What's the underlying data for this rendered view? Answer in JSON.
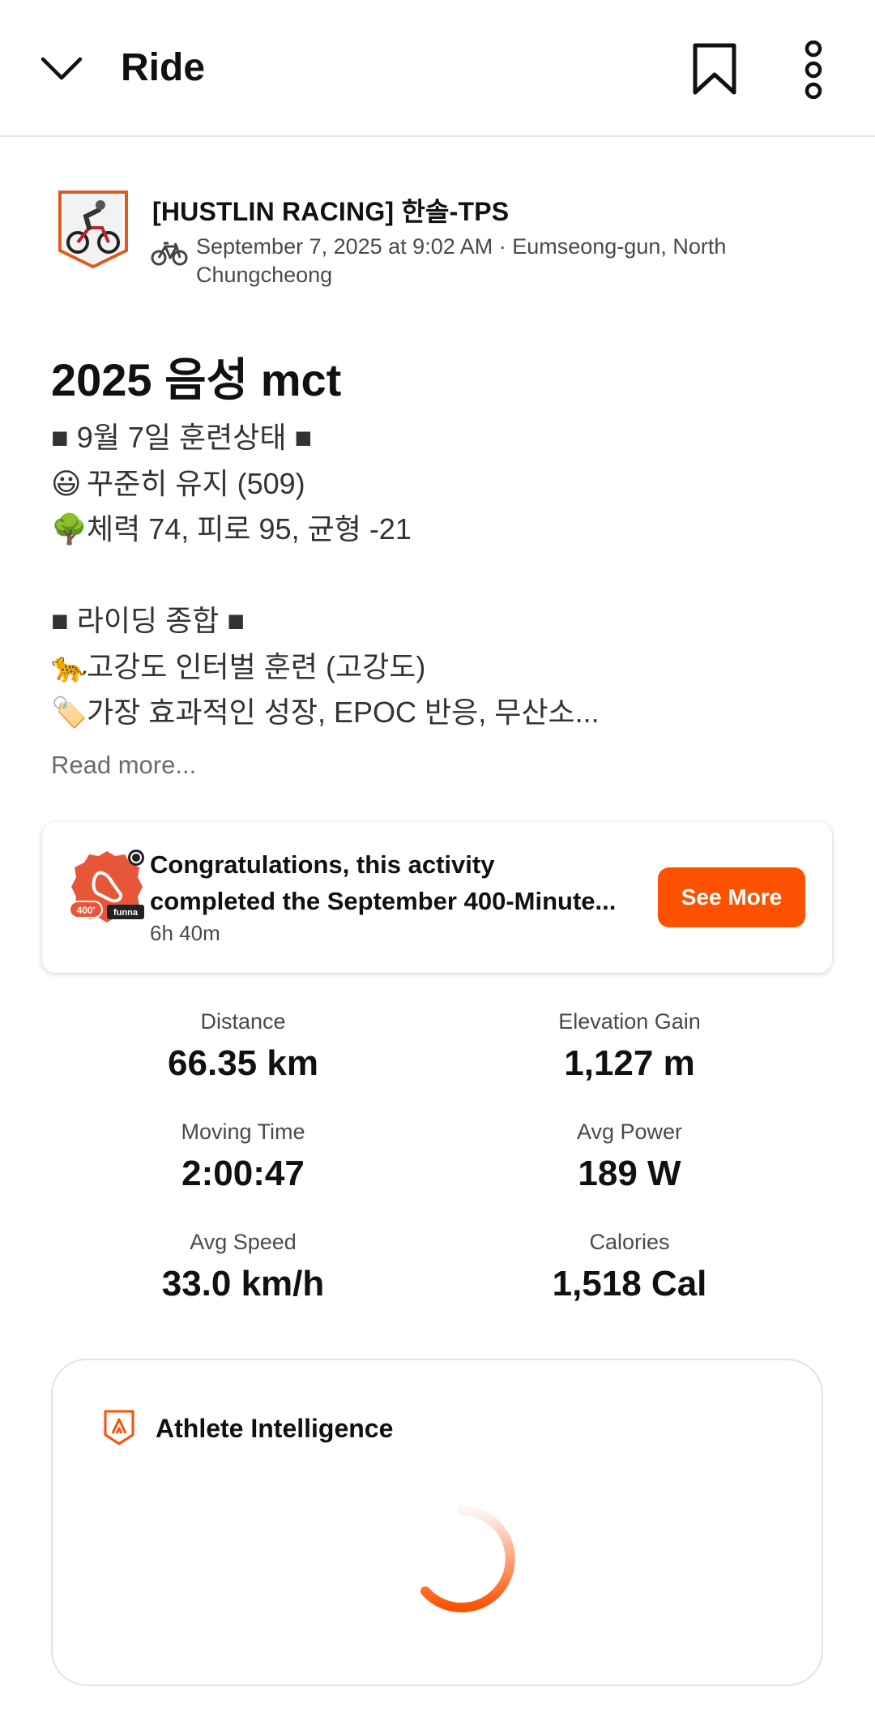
{
  "header": {
    "title": "Ride",
    "back_icon": "chevron-down-icon",
    "bookmark_icon": "bookmark-icon",
    "more_icon": "vertical-ellipsis-icon"
  },
  "athlete": {
    "name": "[HUSTLIN RACING] 한솔-TPS",
    "activity_icon": "bike-icon",
    "meta": "September 7, 2025 at 9:02 AM · Eumseong-gun, North Chungcheong"
  },
  "activity": {
    "title": "2025 음성 mct",
    "description_lines": [
      {
        "emoji": "",
        "text": "■ 9월 7일 훈련상태 ■"
      },
      {
        "emoji": "😃",
        "text": "꾸준히 유지 (509)"
      },
      {
        "emoji": "🌳",
        "text": "체력 74, 피로 95, 균형 -21"
      },
      {
        "emoji": "",
        "text": ""
      },
      {
        "emoji": "",
        "text": "■ 라이딩 종합 ■"
      },
      {
        "emoji": "🐆",
        "text": "고강도 인터벌 훈련 (고강도)"
      },
      {
        "emoji": "🏷️",
        "text": "가장 효과적인 성장, EPOC 반응, 무산소..."
      }
    ],
    "read_more": "Read more..."
  },
  "challenge": {
    "line1": "Congratulations, this activity",
    "line2": "completed the September 400-Minute...",
    "time": "6h 40m",
    "button": "See More",
    "badge_text": "400'",
    "badge_brand": "funna"
  },
  "stats": [
    {
      "label": "Distance",
      "value": "66.35 km"
    },
    {
      "label": "Elevation Gain",
      "value": "1,127 m"
    },
    {
      "label": "Moving Time",
      "value": "2:00:47"
    },
    {
      "label": "Avg Power",
      "value": "189 W"
    },
    {
      "label": "Avg Speed",
      "value": "33.0 km/h"
    },
    {
      "label": "Calories",
      "value": "1,518 Cal"
    }
  ],
  "athlete_intelligence": {
    "title": "Athlete Intelligence"
  },
  "colors": {
    "accent": "#fc5200",
    "text": "#111111",
    "muted": "#4a4a4a"
  }
}
